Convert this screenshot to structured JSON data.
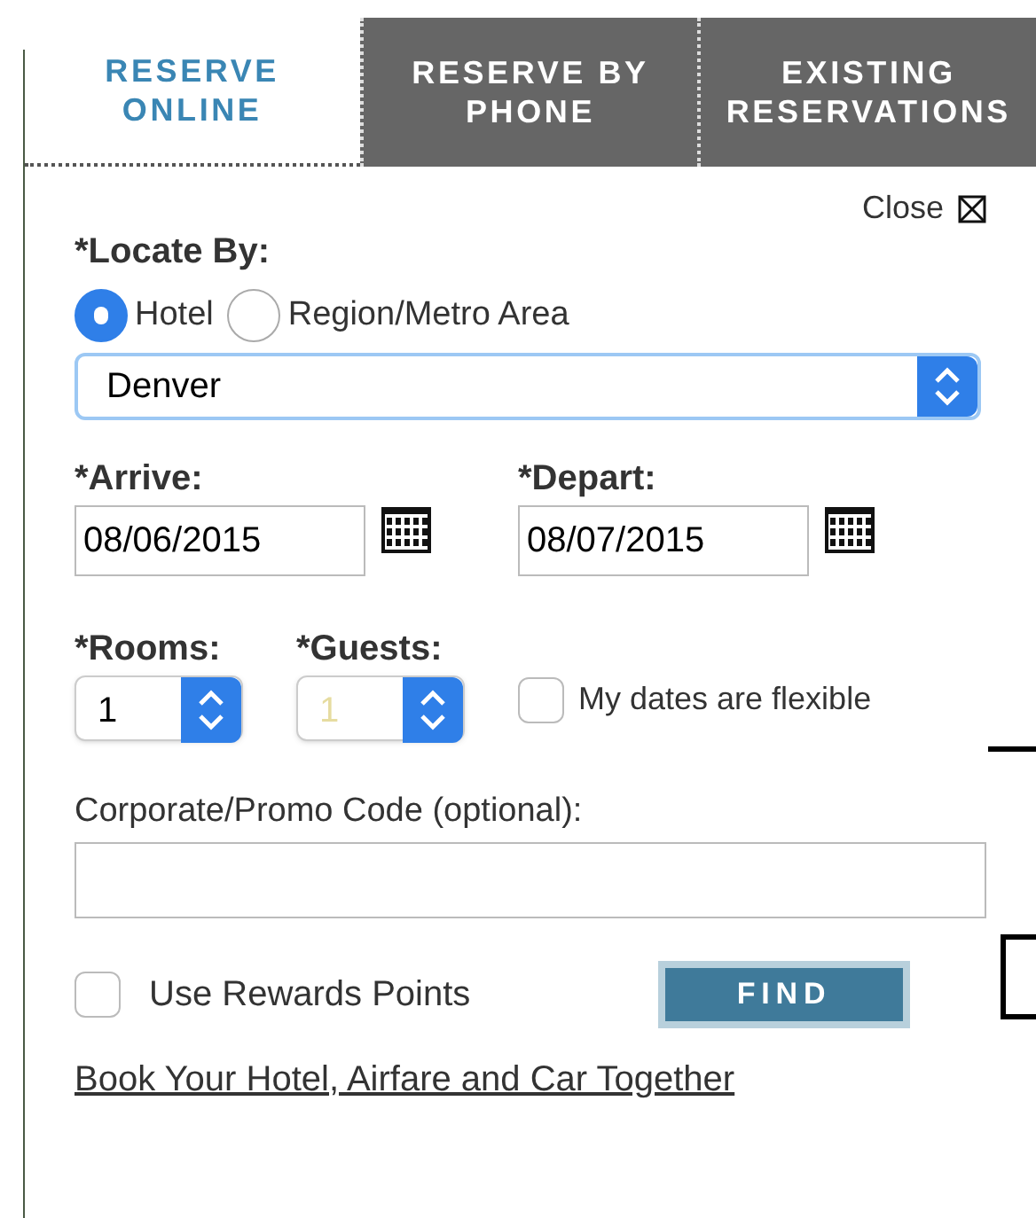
{
  "tabs": [
    {
      "label": "RESERVE ONLINE",
      "selected": true
    },
    {
      "label": "RESERVE BY PHONE",
      "selected": false
    },
    {
      "label": "EXISTING RESERVATIONS",
      "selected": false
    }
  ],
  "close": {
    "label": "Close"
  },
  "locate": {
    "label": "*Locate By:",
    "options": [
      {
        "label": "Hotel",
        "selected": true
      },
      {
        "label": "Region/Metro Area",
        "selected": false
      }
    ],
    "value": "Denver"
  },
  "arrive": {
    "label": "*Arrive:",
    "value": "08/06/2015"
  },
  "depart": {
    "label": "*Depart:",
    "value": "08/07/2015"
  },
  "rooms": {
    "label": "*Rooms:",
    "value": "1",
    "disabled": false
  },
  "guests": {
    "label": "*Guests:",
    "value": "1",
    "disabled": true
  },
  "flexible": {
    "label": "My dates are flexible",
    "checked": false
  },
  "promo": {
    "label": "Corporate/Promo Code (optional):"
  },
  "rewards": {
    "label": "Use Rewards Points",
    "checked": false
  },
  "find_button": "FIND",
  "link": "Book Your Hotel, Airfare and Car Together"
}
